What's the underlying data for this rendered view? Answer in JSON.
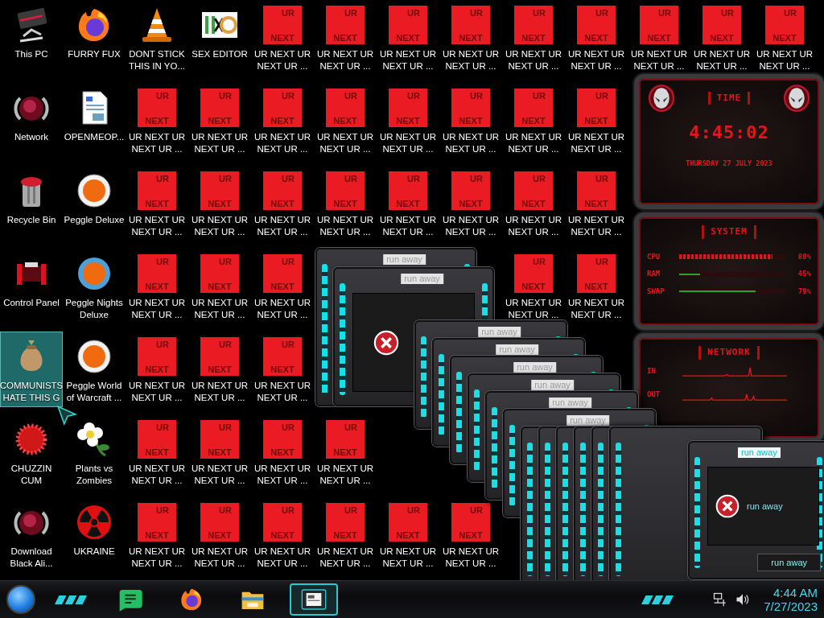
{
  "desktop": {
    "icons": [
      {
        "label": [
          "This PC"
        ],
        "kind": "pc",
        "selected": false
      },
      {
        "label": [
          "FURRY FUX"
        ],
        "kind": "globe",
        "selected": false
      },
      {
        "label": [
          "DONT STICK",
          "THIS IN YO..."
        ],
        "kind": "cone",
        "selected": false
      },
      {
        "label": [
          "SEX EDITOR"
        ],
        "kind": "hexlogo",
        "selected": false
      },
      {
        "label": [
          "UR NEXT UR",
          "NEXT UR ..."
        ],
        "kind": "urnext",
        "tile": [
          "UR",
          "NEXT"
        ],
        "selected": false
      },
      {
        "label": [
          "UR NEXT UR",
          "NEXT UR ..."
        ],
        "kind": "urnext",
        "tile": [
          "UR",
          "NEXT"
        ],
        "selected": false
      },
      {
        "label": [
          "UR NEXT UR",
          "NEXT UR ..."
        ],
        "kind": "urnext",
        "tile": [
          "UR",
          "NEXT"
        ],
        "selected": false
      },
      {
        "label": [
          "UR NEXT UR",
          "NEXT UR ..."
        ],
        "kind": "urnext",
        "tile": [
          "UR",
          "NEXT"
        ],
        "selected": false
      },
      {
        "label": [
          "UR NEXT UR",
          "NEXT UR ..."
        ],
        "kind": "urnext",
        "tile": [
          "UR",
          "NEXT"
        ],
        "selected": false
      },
      {
        "label": [
          "UR NEXT UR",
          "NEXT UR ..."
        ],
        "kind": "urnext",
        "tile": [
          "UR",
          "NEXT"
        ],
        "selected": false
      },
      {
        "label": [
          "UR NEXT UR",
          "NEXT UR ..."
        ],
        "kind": "urnext",
        "tile": [
          "UR",
          "NEXT"
        ],
        "selected": false
      },
      {
        "label": [
          "UR NEXT UR",
          "NEXT UR ..."
        ],
        "kind": "urnext",
        "tile": [
          "UR",
          "NEXT"
        ],
        "selected": false
      },
      {
        "label": [
          "UR NEXT UR",
          "NEXT UR ..."
        ],
        "kind": "urnext",
        "tile": [
          "UR",
          "NEXT"
        ],
        "selected": false
      },
      {
        "label": [
          "Network"
        ],
        "kind": "orb",
        "selected": false
      },
      {
        "label": [
          "OPENMEOP..."
        ],
        "kind": "document",
        "selected": false
      },
      {
        "label": [
          "UR NEXT UR",
          "NEXT UR ..."
        ],
        "kind": "urnext",
        "tile": [
          "UR",
          "NEXT"
        ],
        "selected": false
      },
      {
        "label": [
          "UR NEXT UR",
          "NEXT UR ..."
        ],
        "kind": "urnext",
        "tile": [
          "UR",
          "NEXT"
        ],
        "selected": false
      },
      {
        "label": [
          "UR NEXT UR",
          "NEXT UR ..."
        ],
        "kind": "urnext",
        "tile": [
          "UR",
          "NEXT"
        ],
        "selected": false
      },
      {
        "label": [
          "UR NEXT UR",
          "NEXT UR ..."
        ],
        "kind": "urnext",
        "tile": [
          "UR",
          "NEXT"
        ],
        "selected": false
      },
      {
        "label": [
          "UR NEXT UR",
          "NEXT UR ..."
        ],
        "kind": "urnext",
        "tile": [
          "UR",
          "NEXT"
        ],
        "selected": false
      },
      {
        "label": [
          "UR NEXT UR",
          "NEXT UR ..."
        ],
        "kind": "urnext",
        "tile": [
          "UR",
          "NEXT"
        ],
        "selected": false
      },
      {
        "label": [
          "UR NEXT UR",
          "NEXT UR ..."
        ],
        "kind": "urnext",
        "tile": [
          "UR",
          "NEXT"
        ],
        "selected": false
      },
      {
        "label": [
          "UR NEXT UR",
          "NEXT UR ..."
        ],
        "kind": "urnext",
        "tile": [
          "UR",
          "NEXT"
        ],
        "selected": false
      },
      {
        "label": [
          "Recycle Bin"
        ],
        "kind": "bin",
        "selected": false
      },
      {
        "label": [
          "Peggle Deluxe"
        ],
        "kind": "ball",
        "selected": false
      },
      {
        "label": [
          "UR NEXT UR",
          "NEXT UR ..."
        ],
        "kind": "urnext",
        "tile": [
          "UR",
          "NEXT"
        ],
        "selected": false
      },
      {
        "label": [
          "UR NEXT UR",
          "NEXT UR ..."
        ],
        "kind": "urnext",
        "tile": [
          "UR",
          "NEXT"
        ],
        "selected": false
      },
      {
        "label": [
          "UR NEXT UR",
          "NEXT UR ..."
        ],
        "kind": "urnext",
        "tile": [
          "UR",
          "NEXT"
        ],
        "selected": false
      },
      {
        "label": [
          "UR NEXT UR",
          "NEXT UR ..."
        ],
        "kind": "urnext",
        "tile": [
          "UR",
          "NEXT"
        ],
        "selected": false
      },
      {
        "label": [
          "UR NEXT UR",
          "NEXT UR ..."
        ],
        "kind": "urnext",
        "tile": [
          "UR",
          "NEXT"
        ],
        "selected": false
      },
      {
        "label": [
          "UR NEXT UR",
          "NEXT UR ..."
        ],
        "kind": "urnext",
        "tile": [
          "UR",
          "NEXT"
        ],
        "selected": false
      },
      {
        "label": [
          "UR NEXT UR",
          "NEXT UR ..."
        ],
        "kind": "urnext",
        "tile": [
          "UR",
          "NEXT"
        ],
        "selected": false
      },
      {
        "label": [
          "UR NEXT UR",
          "NEXT UR ..."
        ],
        "kind": "urnext",
        "tile": [
          "UR",
          "NEXT"
        ],
        "selected": false
      },
      {
        "label": [
          "Control Panel"
        ],
        "kind": "console",
        "selected": false
      },
      {
        "label": [
          "Peggle Nights",
          "Deluxe"
        ],
        "kind": "ballnight",
        "selected": false
      },
      {
        "label": [
          "UR NEXT UR",
          "NEXT UR ..."
        ],
        "kind": "urnext",
        "tile": [
          "UR",
          "NEXT"
        ],
        "selected": false
      },
      {
        "label": [
          "UR NEXT UR",
          "NEXT UR ..."
        ],
        "kind": "urnext",
        "tile": [
          "UR",
          "NEXT"
        ],
        "selected": false
      },
      {
        "label": [
          "UR NEXT UR",
          "NEXT UR ..."
        ],
        "kind": "urnext",
        "tile": [
          "UR",
          "NEXT"
        ],
        "selected": false
      },
      {
        "label": [
          "UR NEXT UR",
          "NEXT UR ..."
        ],
        "kind": "urnext",
        "tile": [
          "UR",
          "NEXT"
        ],
        "selected": false
      },
      {
        "label": [
          "UR NEXT UR",
          "NEXT UR ..."
        ],
        "kind": "urnext",
        "tile": [
          "UR",
          "NEXT"
        ],
        "selected": false
      },
      {
        "label": [
          "COMMUNISTS",
          "HATE THIS G"
        ],
        "kind": "moneybag",
        "selected": true
      },
      {
        "label": [
          "Peggle World",
          "of Warcraft ..."
        ],
        "kind": "ball",
        "selected": false
      },
      {
        "label": [
          "UR NEXT UR",
          "NEXT UR ..."
        ],
        "kind": "urnext",
        "tile": [
          "UR",
          "NEXT"
        ],
        "selected": false
      },
      {
        "label": [
          "UR NEXT UR",
          "NEXT UR ..."
        ],
        "kind": "urnext",
        "tile": [
          "UR",
          "NEXT"
        ],
        "selected": false
      },
      {
        "label": [
          "UR NEXT UR",
          "NEXT UR ..."
        ],
        "kind": "urnext",
        "tile": [
          "UR",
          "NEXT"
        ],
        "selected": false
      },
      {
        "label": [
          "CHUZZIN",
          "CUM"
        ],
        "kind": "fuzzball",
        "selected": false
      },
      {
        "label": [
          "Plants vs",
          "Zombies"
        ],
        "kind": "flower",
        "selected": false
      },
      {
        "label": [
          "UR NEXT UR",
          "NEXT UR ..."
        ],
        "kind": "urnext",
        "tile": [
          "UR",
          "NEXT"
        ],
        "selected": false
      },
      {
        "label": [
          "UR NEXT UR",
          "NEXT UR ..."
        ],
        "kind": "urnext",
        "tile": [
          "UR",
          "NEXT"
        ],
        "selected": false
      },
      {
        "label": [
          "UR NEXT UR",
          "NEXT UR ..."
        ],
        "kind": "urnext",
        "tile": [
          "UR",
          "NEXT"
        ],
        "selected": false
      },
      {
        "label": [
          "UR NEXT UR",
          "NEXT UR ..."
        ],
        "kind": "urnext",
        "tile": [
          "UR",
          "NEXT"
        ],
        "selected": false
      },
      {
        "label": [
          "Download",
          "Black Ali..."
        ],
        "kind": "orb",
        "selected": false
      },
      {
        "label": [
          "UKRAINE"
        ],
        "kind": "radiation",
        "selected": false
      },
      {
        "label": [
          "UR NEXT UR",
          "NEXT UR ..."
        ],
        "kind": "urnext",
        "tile": [
          "UR",
          "NEXT"
        ],
        "selected": false
      },
      {
        "label": [
          "UR NEXT UR",
          "NEXT UR ..."
        ],
        "kind": "urnext",
        "tile": [
          "UR",
          "NEXT"
        ],
        "selected": false
      },
      {
        "label": [
          "UR NEXT UR",
          "NEXT UR ..."
        ],
        "kind": "urnext",
        "tile": [
          "UR",
          "NEXT"
        ],
        "selected": false
      },
      {
        "label": [
          "UR NEXT UR",
          "NEXT UR ..."
        ],
        "kind": "urnext",
        "tile": [
          "UR",
          "NEXT"
        ],
        "selected": false
      },
      {
        "label": [
          "UR NEXT UR",
          "NEXT UR ..."
        ],
        "kind": "urnext",
        "tile": [
          "UR",
          "NEXT"
        ],
        "selected": false
      },
      {
        "label": [
          "UR NEXT UR",
          "NEXT UR ..."
        ],
        "kind": "urnext",
        "tile": [
          "UR",
          "NEXT"
        ],
        "selected": false
      }
    ]
  },
  "windows": [
    {
      "title": "run away",
      "kind": "frame"
    },
    {
      "title": "run away",
      "kind": "error"
    },
    {
      "title": "run away",
      "kind": "frame"
    },
    {
      "title": "run away",
      "kind": "frame"
    },
    {
      "title": "run away",
      "kind": "frame"
    },
    {
      "title": "run away",
      "kind": "frame"
    },
    {
      "title": "run away",
      "kind": "frame"
    },
    {
      "title": "run away",
      "kind": "frame"
    },
    {
      "kind": "frame"
    },
    {
      "kind": "frame"
    },
    {
      "kind": "frame"
    },
    {
      "kind": "frame"
    },
    {
      "kind": "frame"
    },
    {
      "kind": "frame"
    }
  ],
  "message_dialog": {
    "title": "run away",
    "message": "run away",
    "button": "run away"
  },
  "widget": {
    "time": {
      "title": "TIME",
      "clock": "4:45:02",
      "date": "THURSDAY 27 JULY 2023"
    },
    "system": {
      "title": "SYSTEM",
      "meters": [
        {
          "name": "CPU",
          "kind": "chevrons",
          "level": 0.88,
          "reading": "88%"
        },
        {
          "name": "RAM",
          "kind": "line",
          "level": 0.2,
          "reading": "45%"
        },
        {
          "name": "SWAP",
          "kind": "line",
          "level": 0.72,
          "reading": "79%"
        }
      ]
    },
    "network": {
      "title": "NETWORK",
      "graphs": [
        {
          "name": "IN"
        },
        {
          "name": "OUT"
        }
      ]
    }
  },
  "taskbar": {
    "apps": [
      {
        "kind": "chat",
        "selected": false
      },
      {
        "kind": "globe",
        "selected": false
      },
      {
        "kind": "folder",
        "selected": false
      },
      {
        "kind": "window",
        "selected": true
      }
    ],
    "clock": {
      "time": "4:44 AM",
      "date": "7/27/2023"
    }
  }
}
